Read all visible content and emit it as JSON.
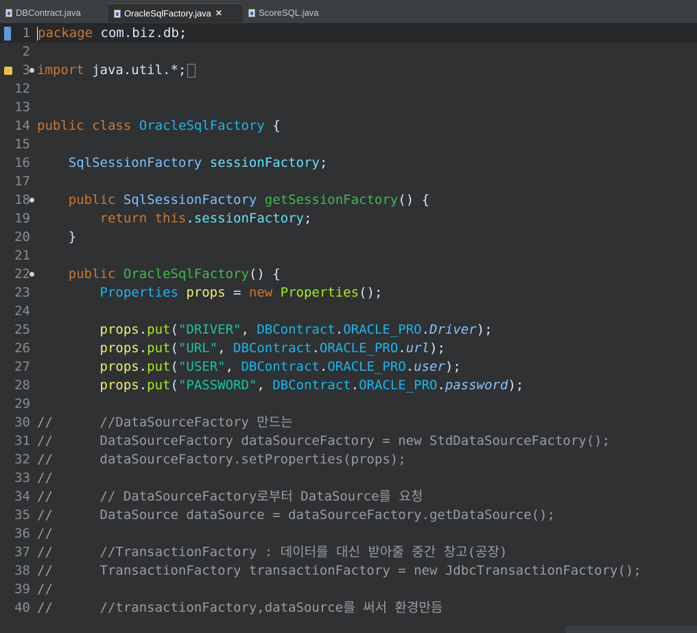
{
  "tabs": [
    {
      "label": "DBContract.java",
      "active": false
    },
    {
      "label": "OracleSqlFactory.java",
      "active": true,
      "close": "✕"
    },
    {
      "label": "ScoreSQL.java",
      "active": false
    }
  ],
  "editor": {
    "lines": [
      {
        "n": "1",
        "parts": [
          [
            "kw",
            "package"
          ],
          [
            "plain",
            " com.biz.db;"
          ]
        ],
        "current": true
      },
      {
        "n": "2",
        "parts": []
      },
      {
        "n": "3",
        "parts": [
          [
            "kw",
            "import"
          ],
          [
            "plain",
            " java.util.*;"
          ]
        ],
        "fold": true
      },
      {
        "n": "12",
        "parts": []
      },
      {
        "n": "13",
        "parts": []
      },
      {
        "n": "14",
        "parts": [
          [
            "kw",
            "public"
          ],
          [
            "plain",
            " "
          ],
          [
            "kw",
            "class"
          ],
          [
            "plain",
            " "
          ],
          [
            "cls",
            "OracleSqlFactory"
          ],
          [
            "plain",
            " {"
          ]
        ]
      },
      {
        "n": "15",
        "parts": []
      },
      {
        "n": "16",
        "parts": [
          [
            "plain",
            "    "
          ],
          [
            "typ",
            "SqlSessionFactory"
          ],
          [
            "plain",
            " "
          ],
          [
            "fld",
            "sessionFactory"
          ],
          [
            "plain",
            ";"
          ]
        ]
      },
      {
        "n": "17",
        "parts": []
      },
      {
        "n": "18",
        "parts": [
          [
            "plain",
            "    "
          ],
          [
            "kw",
            "public"
          ],
          [
            "plain",
            " "
          ],
          [
            "typ",
            "SqlSessionFactory"
          ],
          [
            "plain",
            " "
          ],
          [
            "mth",
            "getSessionFactory"
          ],
          [
            "plain",
            "() {"
          ]
        ],
        "fold": true
      },
      {
        "n": "19",
        "parts": [
          [
            "plain",
            "        "
          ],
          [
            "kw",
            "return"
          ],
          [
            "plain",
            " "
          ],
          [
            "kw",
            "this"
          ],
          [
            "plain",
            "."
          ],
          [
            "fld",
            "sessionFactory"
          ],
          [
            "plain",
            ";"
          ]
        ]
      },
      {
        "n": "20",
        "parts": [
          [
            "plain",
            "    }"
          ]
        ]
      },
      {
        "n": "21",
        "parts": []
      },
      {
        "n": "22",
        "parts": [
          [
            "plain",
            "    "
          ],
          [
            "kw",
            "public"
          ],
          [
            "plain",
            " "
          ],
          [
            "mth",
            "OracleSqlFactory"
          ],
          [
            "plain",
            "() {"
          ]
        ],
        "fold": true
      },
      {
        "n": "23",
        "parts": [
          [
            "plain",
            "        "
          ],
          [
            "cls",
            "Properties"
          ],
          [
            "plain",
            " "
          ],
          [
            "var",
            "props"
          ],
          [
            "plain",
            " = "
          ],
          [
            "kw",
            "new"
          ],
          [
            "plain",
            " "
          ],
          [
            "ctor",
            "Properties"
          ],
          [
            "plain",
            "();"
          ]
        ]
      },
      {
        "n": "24",
        "parts": []
      },
      {
        "n": "25",
        "parts": [
          [
            "plain",
            "        "
          ],
          [
            "var",
            "props"
          ],
          [
            "plain",
            "."
          ],
          [
            "ctor",
            "put"
          ],
          [
            "plain",
            "("
          ],
          [
            "str",
            "\"DRIVER\""
          ],
          [
            "plain",
            ", "
          ],
          [
            "cls",
            "DBContract"
          ],
          [
            "plain",
            "."
          ],
          [
            "cls",
            "ORACLE_PRO"
          ],
          [
            "plain",
            "."
          ],
          [
            "ital",
            "Driver"
          ],
          [
            "plain",
            ");"
          ]
        ]
      },
      {
        "n": "26",
        "parts": [
          [
            "plain",
            "        "
          ],
          [
            "var",
            "props"
          ],
          [
            "plain",
            "."
          ],
          [
            "ctor",
            "put"
          ],
          [
            "plain",
            "("
          ],
          [
            "str",
            "\"URL\""
          ],
          [
            "plain",
            ", "
          ],
          [
            "cls",
            "DBContract"
          ],
          [
            "plain",
            "."
          ],
          [
            "cls",
            "ORACLE_PRO"
          ],
          [
            "plain",
            "."
          ],
          [
            "ital",
            "url"
          ],
          [
            "plain",
            ");"
          ]
        ]
      },
      {
        "n": "27",
        "parts": [
          [
            "plain",
            "        "
          ],
          [
            "var",
            "props"
          ],
          [
            "plain",
            "."
          ],
          [
            "ctor",
            "put"
          ],
          [
            "plain",
            "("
          ],
          [
            "str",
            "\"USER\""
          ],
          [
            "plain",
            ", "
          ],
          [
            "cls",
            "DBContract"
          ],
          [
            "plain",
            "."
          ],
          [
            "cls",
            "ORACLE_PRO"
          ],
          [
            "plain",
            "."
          ],
          [
            "ital",
            "user"
          ],
          [
            "plain",
            ");"
          ]
        ]
      },
      {
        "n": "28",
        "parts": [
          [
            "plain",
            "        "
          ],
          [
            "var",
            "props"
          ],
          [
            "plain",
            "."
          ],
          [
            "ctor",
            "put"
          ],
          [
            "plain",
            "("
          ],
          [
            "str",
            "\"PASSWORD\""
          ],
          [
            "plain",
            ", "
          ],
          [
            "cls",
            "DBContract"
          ],
          [
            "plain",
            "."
          ],
          [
            "cls",
            "ORACLE_PRO"
          ],
          [
            "plain",
            "."
          ],
          [
            "ital",
            "password"
          ],
          [
            "plain",
            ");"
          ]
        ]
      },
      {
        "n": "29",
        "parts": []
      },
      {
        "n": "30",
        "parts": [
          [
            "cmt",
            "//      //DataSourceFactory 만드는"
          ]
        ]
      },
      {
        "n": "31",
        "parts": [
          [
            "cmt",
            "//      DataSourceFactory dataSourceFactory = new StdDataSourceFactory();"
          ]
        ]
      },
      {
        "n": "32",
        "parts": [
          [
            "cmt",
            "//      dataSourceFactory.setProperties(props);"
          ]
        ]
      },
      {
        "n": "33",
        "parts": [
          [
            "cmt",
            "//"
          ]
        ]
      },
      {
        "n": "34",
        "parts": [
          [
            "cmt",
            "//      // DataSourceFactory로부터 DataSource를 요청"
          ]
        ]
      },
      {
        "n": "35",
        "parts": [
          [
            "cmt",
            "//      DataSource dataSource = dataSourceFactory.getDataSource();"
          ]
        ]
      },
      {
        "n": "36",
        "parts": [
          [
            "cmt",
            "//"
          ]
        ]
      },
      {
        "n": "37",
        "parts": [
          [
            "cmt",
            "//      //TransactionFactory : 데이터를 대신 받아줄 중간 창고(공장)"
          ]
        ]
      },
      {
        "n": "38",
        "parts": [
          [
            "cmt",
            "//      TransactionFactory transactionFactory = new JdbcTransactionFactory();"
          ]
        ]
      },
      {
        "n": "39",
        "parts": [
          [
            "cmt",
            "//"
          ]
        ]
      },
      {
        "n": "40",
        "parts": [
          [
            "cmt",
            "//      //transactionFactory,dataSource를 써서 환경만듬"
          ]
        ]
      }
    ]
  }
}
